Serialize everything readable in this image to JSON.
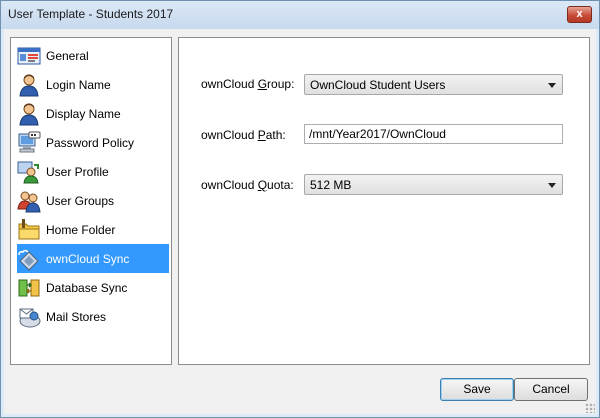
{
  "window": {
    "title": "User Template - Students 2017",
    "close_glyph": "x"
  },
  "nav": {
    "items": [
      {
        "label": "General",
        "icon": "id-card-icon"
      },
      {
        "label": "Login Name",
        "icon": "user-icon"
      },
      {
        "label": "Display Name",
        "icon": "user-icon"
      },
      {
        "label": "Password Policy",
        "icon": "computer-password-icon"
      },
      {
        "label": "User Profile",
        "icon": "user-profile-icon"
      },
      {
        "label": "User Groups",
        "icon": "users-group-icon"
      },
      {
        "label": "Home Folder",
        "icon": "folder-icon"
      },
      {
        "label": "ownCloud Sync",
        "icon": "cloud-sync-icon",
        "selected": true
      },
      {
        "label": "Database Sync",
        "icon": "database-sync-icon"
      },
      {
        "label": "Mail Stores",
        "icon": "mail-store-icon"
      }
    ]
  },
  "form": {
    "group": {
      "label_pre": "ownCloud ",
      "label_key": "G",
      "label_post": "roup:",
      "value": "OwnCloud Student Users"
    },
    "path": {
      "label_pre": "ownCloud ",
      "label_key": "P",
      "label_post": "ath:",
      "value": "/mnt/Year2017/OwnCloud"
    },
    "quota": {
      "label_pre": "ownCloud ",
      "label_key": "Q",
      "label_post": "uota:",
      "value": "512 MB"
    }
  },
  "buttons": {
    "save": "Save",
    "cancel": "Cancel"
  },
  "colors": {
    "selection": "#3399ff",
    "frame": "#dce9f6",
    "close": "#c84c39"
  }
}
